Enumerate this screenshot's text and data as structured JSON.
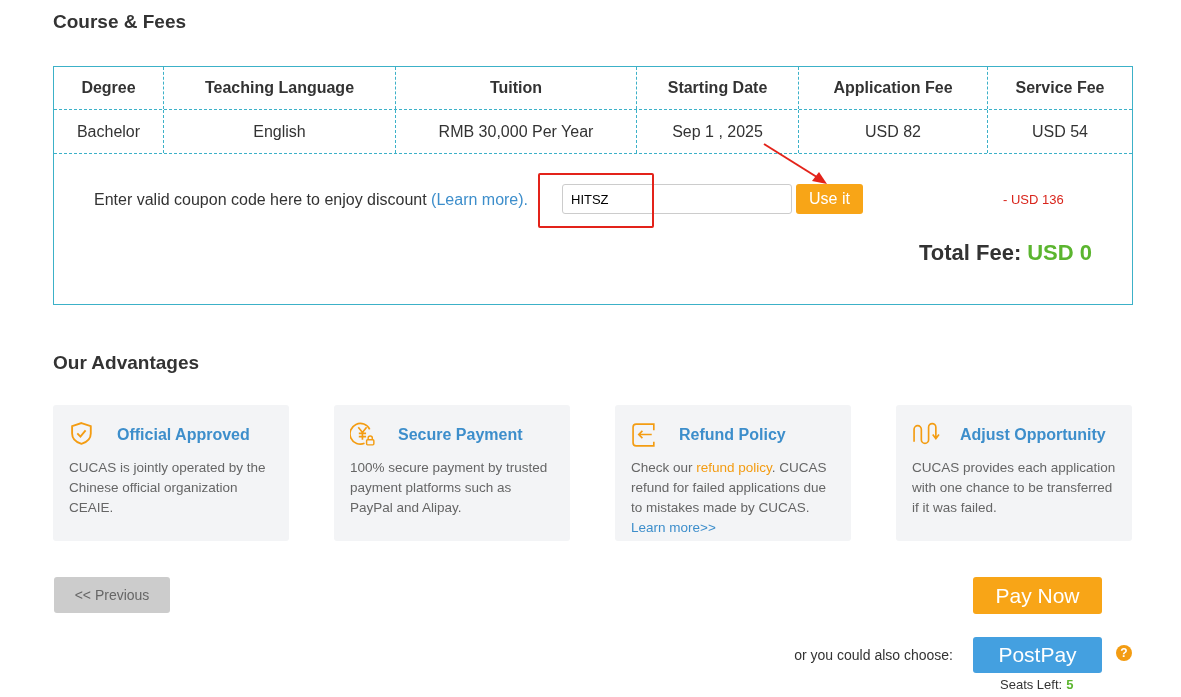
{
  "course_section": {
    "title": "Course & Fees",
    "table": {
      "columns": [
        "Degree",
        "Teaching Language",
        "Tuition",
        "Starting Date",
        "Application Fee",
        "Service Fee"
      ],
      "rows": [
        [
          "Bachelor",
          "English",
          "RMB 30,000 Per Year",
          "Sep 1 , 2025",
          "USD 82",
          "USD 54"
        ]
      ]
    },
    "coupon": {
      "prompt": "Enter valid coupon code here to enjoy discount",
      "learn_more": "(Learn more).",
      "value": "HITSZ",
      "button": "Use it",
      "discount": "- USD 136"
    },
    "total": {
      "label": "Total Fee:",
      "amount": "USD 0"
    }
  },
  "advantages": {
    "title": "Our Advantages",
    "cards": [
      {
        "title": "Official Approved",
        "body": [
          {
            "kind": "text",
            "text": "CUCAS is jointly operated by the Chinese official organization CEAIE."
          }
        ]
      },
      {
        "title": "Secure Payment",
        "body": [
          {
            "kind": "text",
            "text": "100% secure payment by trusted payment platforms such as PayPal and Alipay."
          }
        ]
      },
      {
        "title": "Refund Policy",
        "body": [
          {
            "kind": "text",
            "text": "Check our "
          },
          {
            "kind": "policy_link",
            "text": "refund policy"
          },
          {
            "kind": "text",
            "text": ". CUCAS refund for failed applications due to mistakes made by CUCAS. "
          },
          {
            "kind": "more_link",
            "text": "Learn more>>"
          }
        ]
      },
      {
        "title": "Adjust Opportunity",
        "body": [
          {
            "kind": "text",
            "text": "CUCAS provides each application with one chance to be transferred if it was failed."
          }
        ]
      }
    ]
  },
  "footer": {
    "previous": "<< Previous",
    "pay_now": "Pay Now",
    "alt_prompt": "or you could also choose:",
    "postpay": "PostPay",
    "help": "?",
    "seats_label": "Seats Left:",
    "seats": "5"
  }
}
